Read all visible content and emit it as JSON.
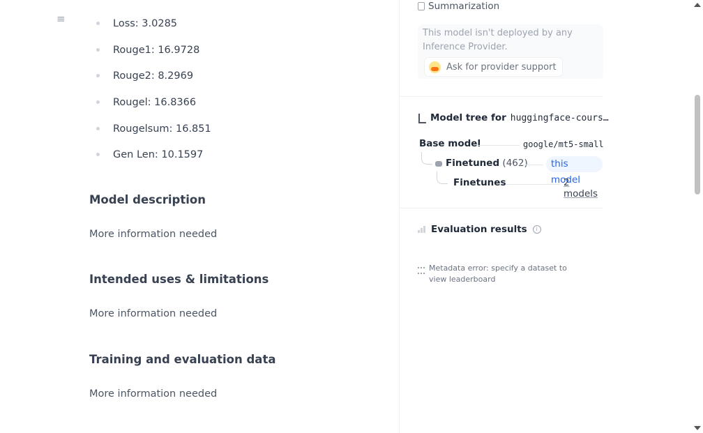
{
  "icons": {
    "toc": "menu-icon",
    "task": "copy-icon",
    "provider": "hugging-face-icon",
    "tree": "tree-icon",
    "eval": "bar-chart-icon",
    "info": "info-icon",
    "meta": "list-icon"
  },
  "metrics": [
    "Loss: 3.0285",
    "Rouge1: 16.9728",
    "Rouge2: 8.2969",
    "Rougel: 16.8366",
    "Rougelsum: 16.851",
    "Gen Len: 10.1597"
  ],
  "sections": [
    {
      "heading": "Model description",
      "body": "More information needed"
    },
    {
      "heading": "Intended uses & limitations",
      "body": "More information needed"
    },
    {
      "heading": "Training and evaluation data",
      "body": "More information needed"
    }
  ],
  "sidebar": {
    "task_label": "Summarization",
    "inference_message": "This model isn't deployed by any Inference Provider.",
    "ask_provider_label": "Ask for provider support",
    "tree_title_prefix": "Model tree for",
    "tree_model": "huggingface-cours…",
    "base_model_label": "Base model",
    "base_model_value": "google/mt5-small",
    "finetuned_label": "Finetuned",
    "finetuned_count": "(462)",
    "this_model_label": "this model",
    "finetunes_label": "Finetunes",
    "finetunes_value": "2 models",
    "eval_title": "Evaluation results",
    "metadata_error": "Metadata error: specify a dataset to view leaderboard"
  }
}
